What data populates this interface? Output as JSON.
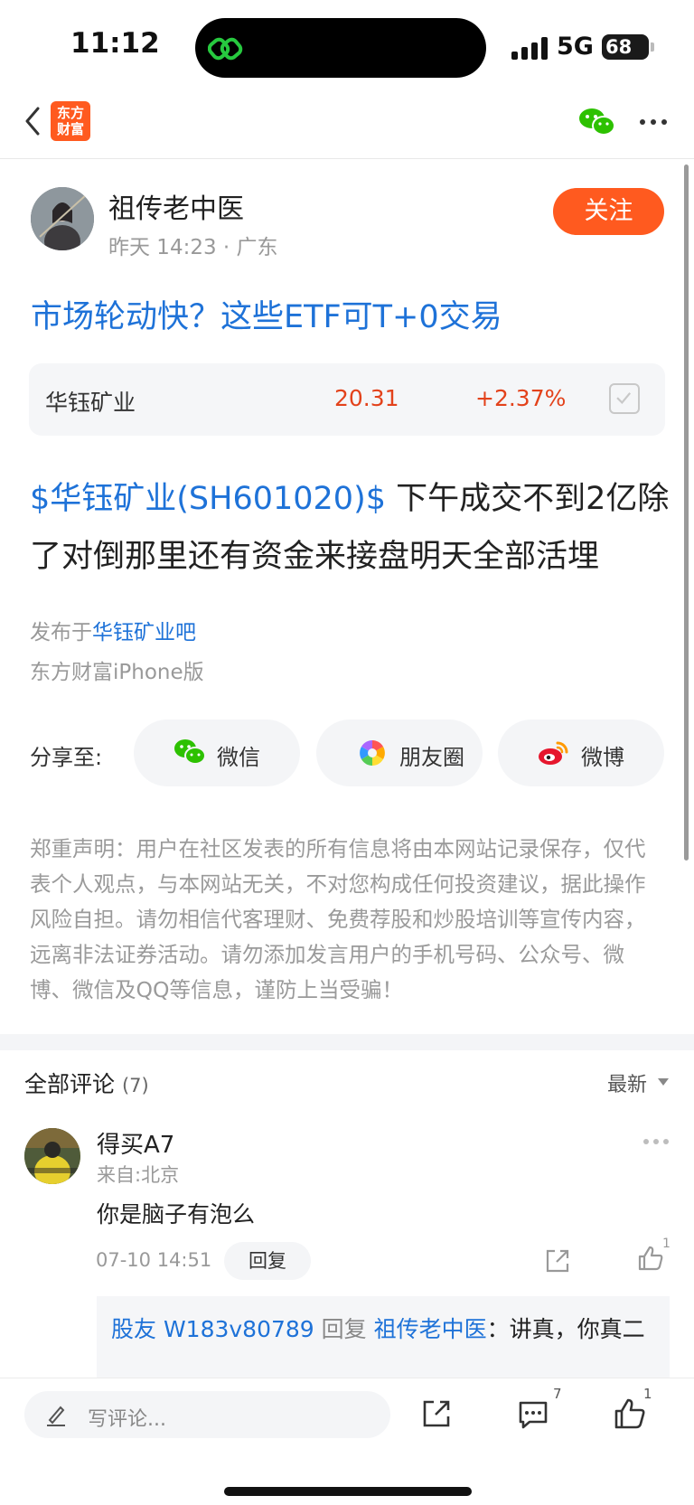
{
  "status_bar": {
    "time": "11:12",
    "network": "5G",
    "battery": "68"
  },
  "nav": {
    "logo_line1": "东方",
    "logo_line2": "财富"
  },
  "author": {
    "name": "祖传老中医",
    "date": "昨天 14:23",
    "location": "广东",
    "follow_label": "关注"
  },
  "post": {
    "title": "市场轮动快？这些ETF可T+0交易",
    "stock": {
      "name": "华钰矿业",
      "price": "20.31",
      "change": "+2.37%"
    },
    "mention": "$华钰矿业(SH601020)$",
    "body": "  下午成交不到2亿除了对倒那里还有资金来接盘明天全部活埋",
    "publish_prefix": "发布于",
    "publish_bar": "华钰矿业吧",
    "client": "东方财富iPhone版"
  },
  "share": {
    "label": "分享至:",
    "wechat": "微信",
    "moments": "朋友圈",
    "weibo": "微博"
  },
  "disclaimer": "郑重声明：用户在社区发表的所有信息将由本网站记录保存，仅代表个人观点，与本网站无关，不对您构成任何投资建议，据此操作风险自担。请勿相信代客理财、免费荐股和炒股培训等宣传内容，远离非法证券活动。请勿添加发言用户的手机号码、公众号、微博、微信及QQ等信息，谨防上当受骗！",
  "comments": {
    "title": "全部评论",
    "count": "(7)",
    "sort": "最新",
    "items": [
      {
        "name": "得买A7",
        "from": "来自:北京",
        "text": "你是脑子有泡么",
        "date": "07-10 14:51",
        "reply_label": "回复",
        "likes": "1",
        "sub_reply": {
          "user": "股友 W183v80789",
          "verb": " 回复 ",
          "target": "祖传老中医",
          "sep": "：",
          "text": "讲真，你真二"
        }
      }
    ]
  },
  "bottom_bar": {
    "placeholder": "写评论...",
    "comment_count": "7",
    "like_count": "1"
  }
}
